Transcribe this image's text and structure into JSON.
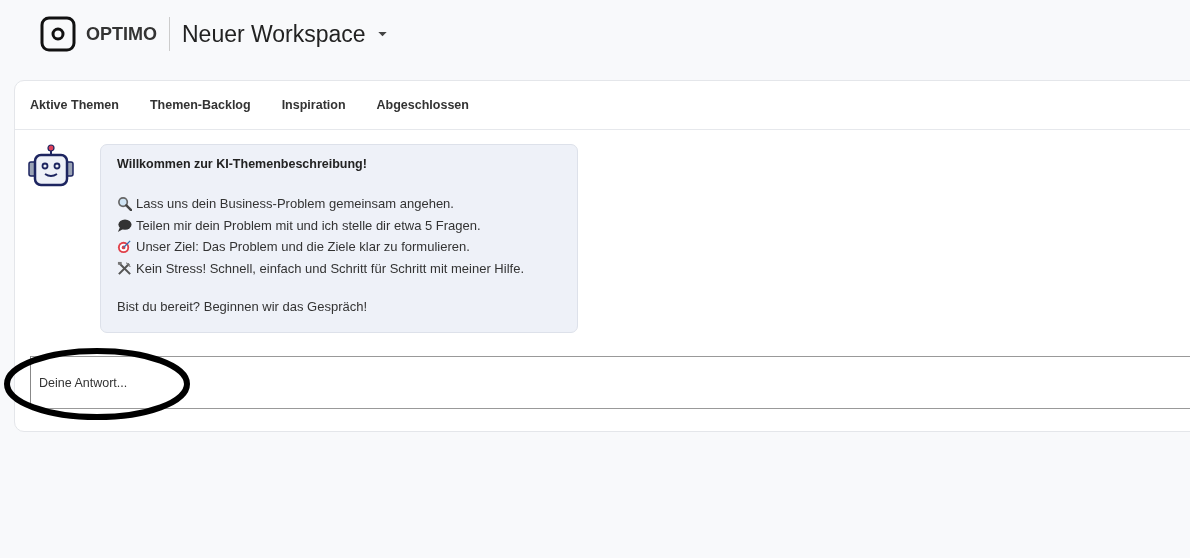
{
  "header": {
    "logo_text": "OPTIMO",
    "workspace": "Neuer Workspace"
  },
  "tabs": [
    {
      "label": "Aktive Themen"
    },
    {
      "label": "Themen-Backlog"
    },
    {
      "label": "Inspiration"
    },
    {
      "label": "Abgeschlossen"
    }
  ],
  "chat": {
    "message": {
      "title": "Willkommen zur KI-Themenbeschreibung!",
      "lines": [
        "Lass uns dein Business-Problem gemeinsam angehen.",
        "Teilen mir dein Problem mit und ich stelle dir etwa 5 Fragen.",
        "Unser Ziel: Das Problem und die Ziele klar zu formulieren.",
        "Kein Stress! Schnell, einfach und Schritt für Schritt mit meiner Hilfe."
      ],
      "closing": "Bist du bereit? Beginnen wir das Gespräch!"
    },
    "answer": {
      "placeholder": "Deine Antwort..."
    }
  },
  "annotations": [
    {
      "kind": "ellipse"
    }
  ]
}
